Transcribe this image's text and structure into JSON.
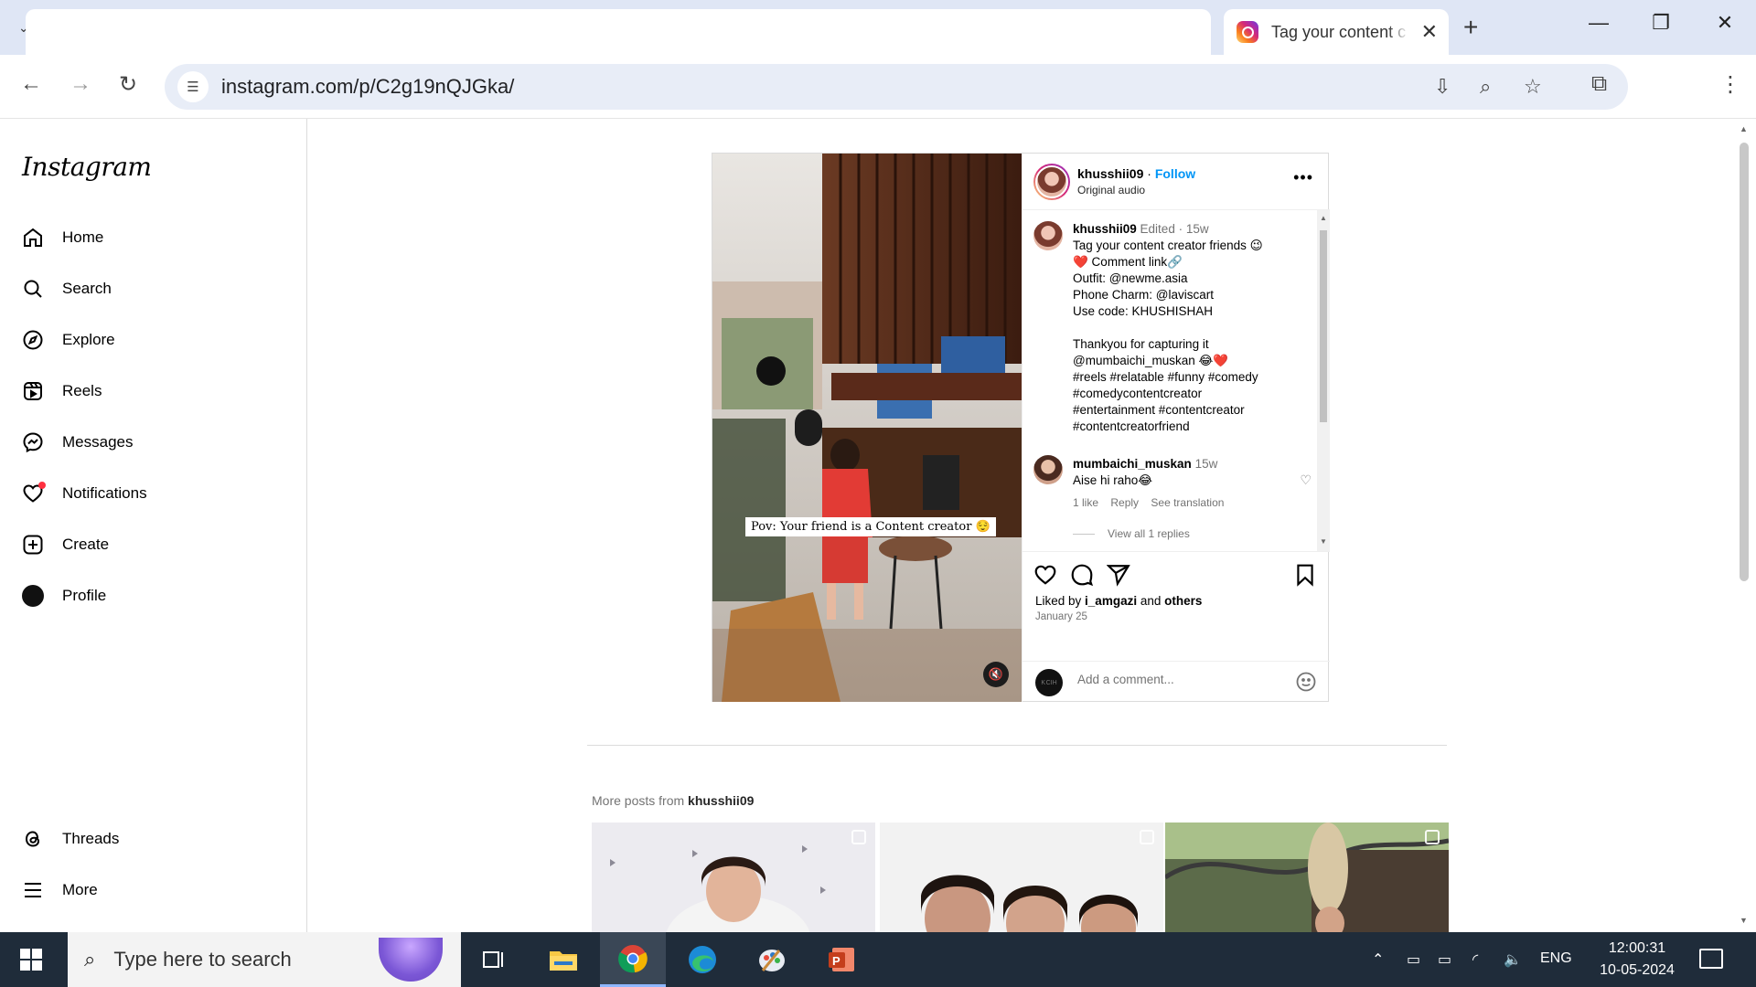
{
  "browser": {
    "tab_title": "Tag your content c",
    "url": "instagram.com/p/C2g19nQJGka/"
  },
  "sidebar": {
    "logo": "Instagram",
    "items": [
      {
        "label": "Home",
        "icon": "home-icon"
      },
      {
        "label": "Search",
        "icon": "search-icon"
      },
      {
        "label": "Explore",
        "icon": "compass-icon"
      },
      {
        "label": "Reels",
        "icon": "reels-icon"
      },
      {
        "label": "Messages",
        "icon": "messenger-icon"
      },
      {
        "label": "Notifications",
        "icon": "heart-icon"
      },
      {
        "label": "Create",
        "icon": "plus-square-icon"
      },
      {
        "label": "Profile",
        "icon": "avatar-icon"
      },
      {
        "label": "Threads",
        "icon": "threads-icon"
      },
      {
        "label": "More",
        "icon": "hamburger-icon"
      }
    ]
  },
  "post": {
    "video_caption": "Pov: Your friend is a Content creator 😌",
    "header": {
      "username": "khusshii09",
      "separator": "·",
      "follow": "Follow",
      "audio": "Original audio"
    },
    "caption": {
      "username": "khusshii09",
      "edited": "Edited",
      "dot": "·",
      "age": "15w",
      "lines": [
        "Tag your content creator friends 😉",
        "❤️ Comment link🔗",
        "Outfit: @newme.asia",
        "Phone Charm: @laviscart",
        "Use code: KHUSHISHAH",
        "",
        "Thankyou for capturing it",
        "@mumbaichi_muskan 😂❤️",
        "#reels #relatable #funny #comedy",
        "#comedycontentcreator",
        "#entertainment #contentcreator",
        "#contentcreatorfriend"
      ]
    },
    "comment": {
      "username": "mumbaichi_muskan",
      "age": "15w",
      "text": "Aise hi raho😂",
      "likes": "1 like",
      "reply": "Reply",
      "translate": "See translation",
      "view_replies": "View all 1 replies"
    },
    "liked_by": {
      "prefix": "Liked by ",
      "user": "i_amgazi",
      "middle": " and ",
      "others": "others"
    },
    "date": "January 25",
    "comment_placeholder": "Add a comment...",
    "self_avatar_text": "K CIH"
  },
  "more_posts": {
    "prefix": "More posts from ",
    "username": "khusshii09"
  },
  "taskbar": {
    "search_placeholder": "Type here to search",
    "language": "ENG",
    "time": "12:00:31",
    "date": "10-05-2024"
  },
  "colors": {
    "link_blue": "#0095f6",
    "notification_dot": "#ff3040",
    "taskbar": "#1f2c3a"
  }
}
